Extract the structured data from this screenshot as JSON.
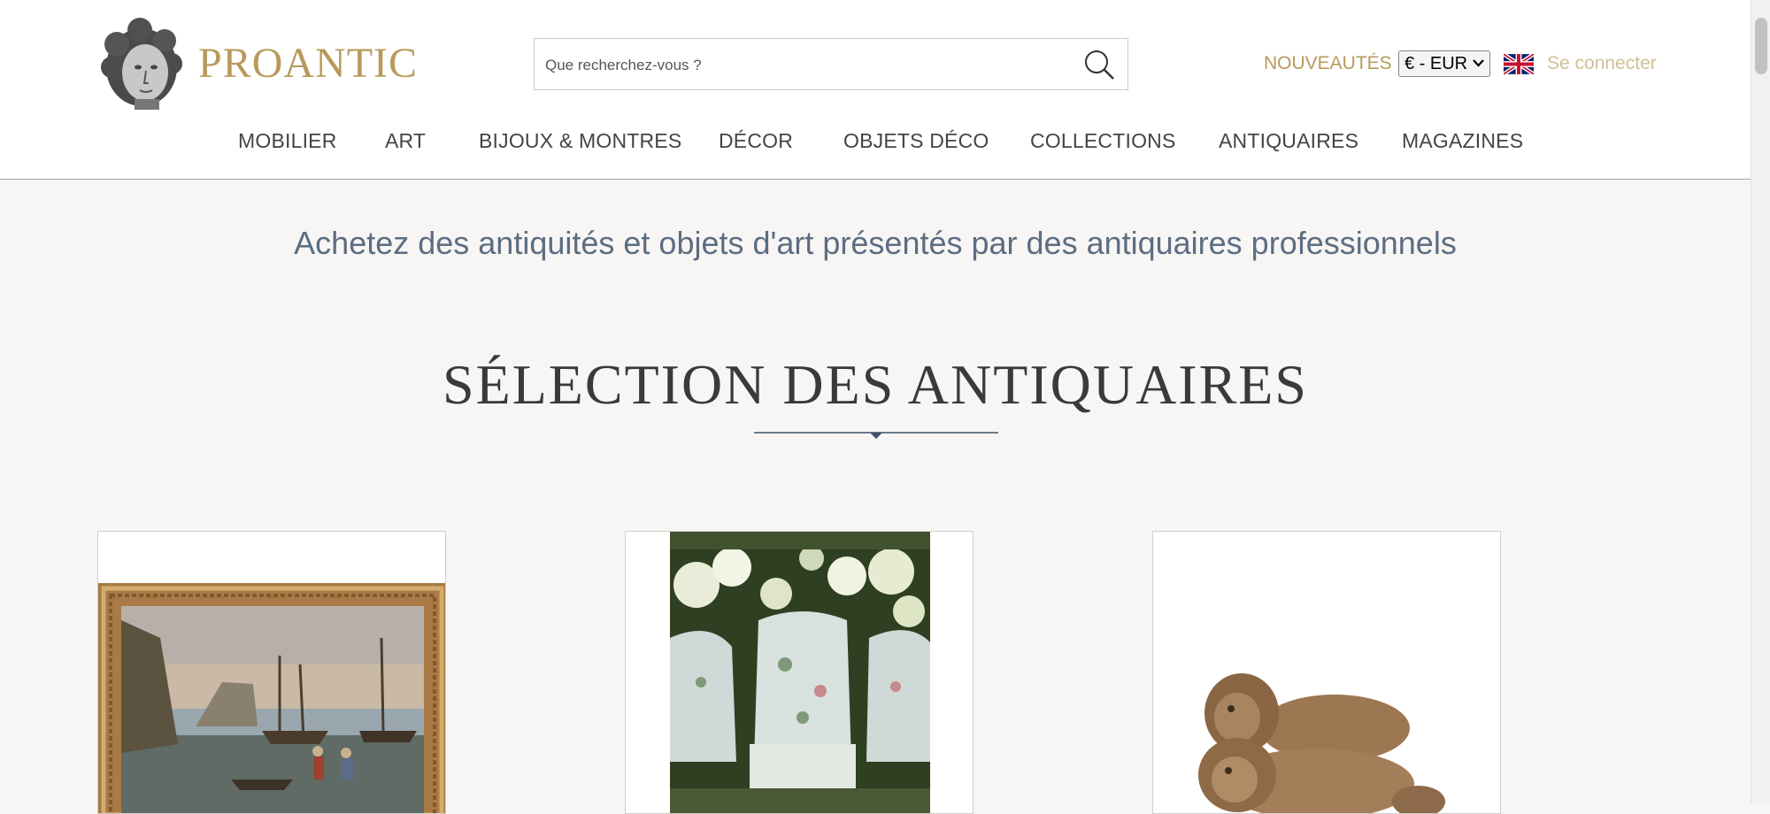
{
  "header": {
    "brand": "PROANTIC",
    "search": {
      "placeholder": "Que recherchez-vous ?",
      "value": ""
    },
    "new_label": "NOUVEAUTÉS",
    "currency": "€ - EUR",
    "language_flag": "uk-flag-icon",
    "login_label": "Se connecter"
  },
  "nav": {
    "items": [
      "MOBILIER",
      "ART",
      "BIJOUX & MONTRES",
      "DÉCOR",
      "OBJETS DÉCO",
      "COLLECTIONS",
      "ANTIQUAIRES",
      "MAGAZINES"
    ]
  },
  "main": {
    "tagline": "Achetez des antiquités et objets d'art présentés par des antiquaires professionnels",
    "section_title": "SÉLECTION DES ANTIQUAIRES",
    "products": [
      {
        "image": "framed-seascape-painting"
      },
      {
        "image": "upholstered-armchairs-garden"
      },
      {
        "image": "carved-wooden-lions"
      }
    ]
  },
  "colors": {
    "brand_gold": "#b79a5b",
    "tagline_blue": "#5c6d82",
    "page_bg": "#f7f6f4"
  }
}
